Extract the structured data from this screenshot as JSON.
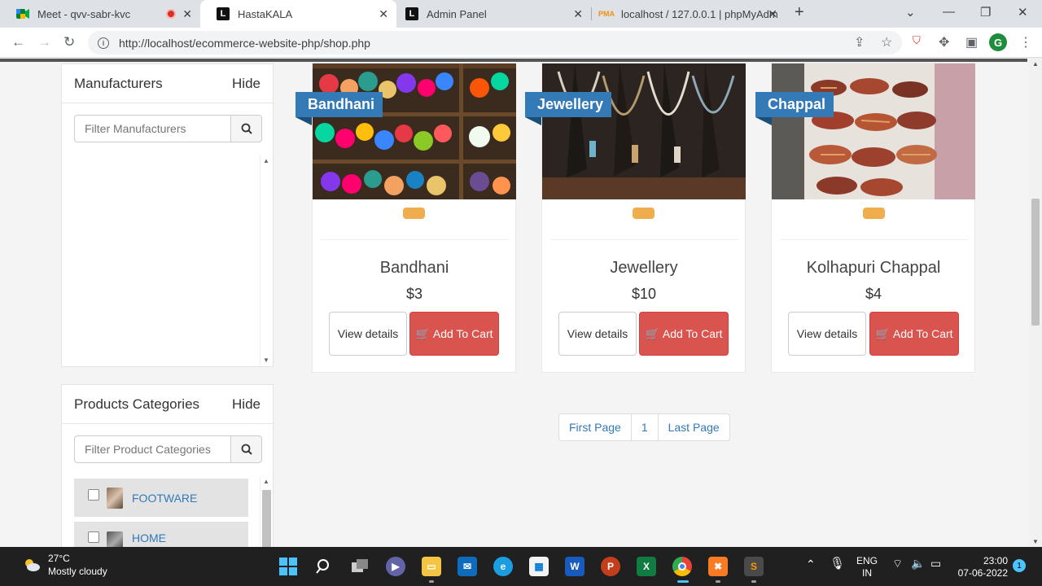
{
  "browser": {
    "tabs": [
      {
        "title": "Meet - qvv-sabr-kvc",
        "active": false
      },
      {
        "title": "HastaKALA",
        "active": true
      },
      {
        "title": "Admin Panel",
        "active": false
      },
      {
        "title": "localhost / 127.0.0.1 | phpMyAdm",
        "active": false
      }
    ],
    "url": "http://localhost/ecommerce-website-php/shop.php",
    "profile_initial": "G"
  },
  "sidebar": {
    "manufacturers": {
      "title": "Manufacturers",
      "hide_label": "Hide",
      "filter_placeholder": "Filter Manufacturers"
    },
    "categories": {
      "title": "Products Categories",
      "hide_label": "Hide",
      "filter_placeholder": "Filter Product Categories",
      "items": [
        {
          "label": "FOOTWARE"
        },
        {
          "label": "HOME"
        }
      ]
    }
  },
  "products": [
    {
      "ribbon": "Bandhani",
      "name": "Bandhani",
      "price": "$3",
      "view_label": "View details",
      "cart_label": "Add To Cart"
    },
    {
      "ribbon": "Jewellery",
      "name": "Jewellery",
      "price": "$10",
      "view_label": "View details",
      "cart_label": "Add To Cart"
    },
    {
      "ribbon": "Chappal",
      "name": "Kolhapuri Chappal",
      "price": "$4",
      "view_label": "View details",
      "cart_label": "Add To Cart"
    }
  ],
  "pagination": {
    "first": "First Page",
    "page": "1",
    "last": "Last Page"
  },
  "taskbar": {
    "temperature": "27°C",
    "weather": "Mostly cloudy",
    "lang_top": "ENG",
    "lang_bottom": "IN",
    "time": "23:00",
    "date": "07-06-2022",
    "notifications": "1"
  },
  "colors": {
    "brand_blue": "#337ab7",
    "cart_red": "#d9534f",
    "badge_orange": "#f0ad4e"
  }
}
